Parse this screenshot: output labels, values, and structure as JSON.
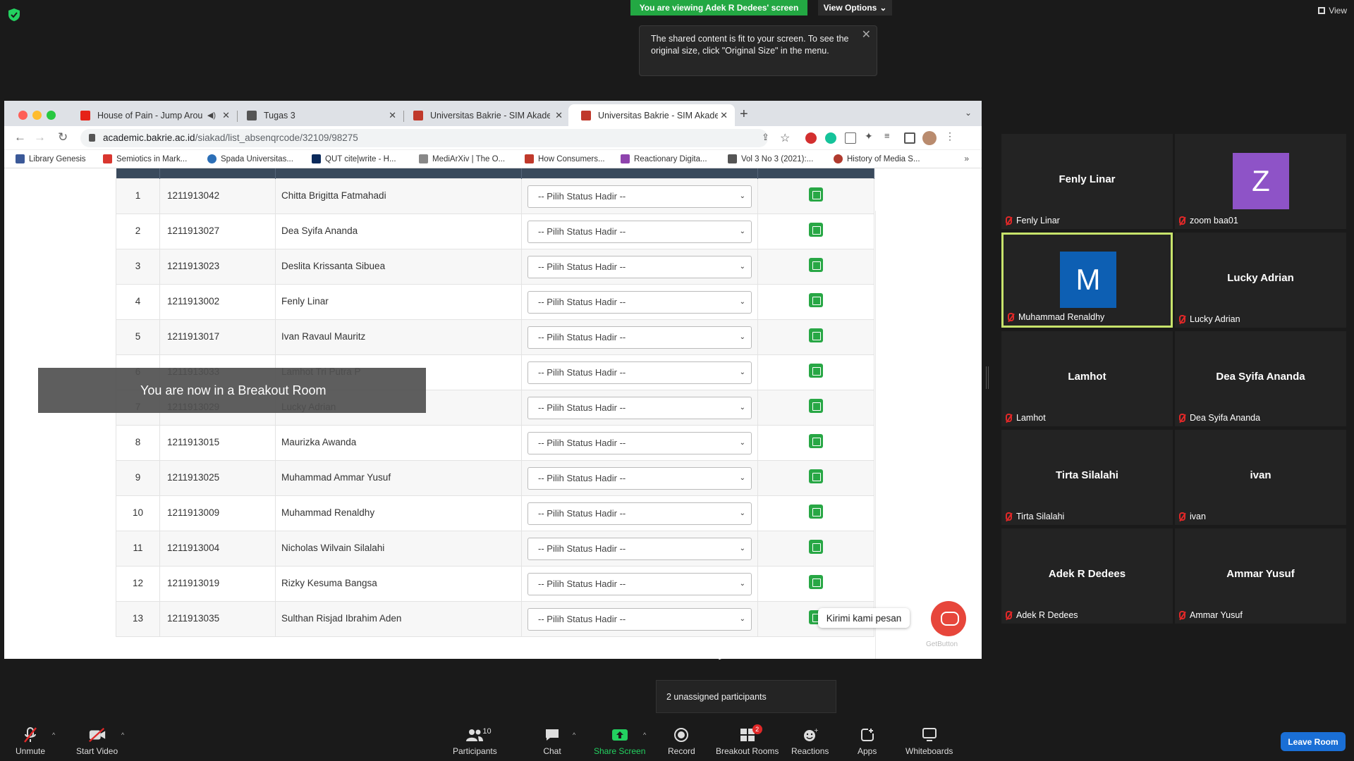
{
  "zoom": {
    "viewing_banner": "You are viewing Adek R Dedees' screen",
    "view_options": "View Options",
    "view_label": "View",
    "tooltip": "The shared content is fit to your screen. To see the original size, click \"Original Size\" in the menu.",
    "breakout_toast": "You are now in a Breakout Room",
    "unassigned": "2 unassigned participants",
    "leave_room": "Leave Room",
    "chat_widget_bubble": "Kirimi kami pesan",
    "getbutton": "GetButton"
  },
  "browser": {
    "tabs": [
      {
        "title": "House of Pain - Jump Arou",
        "color": "#e62117"
      },
      {
        "title": "Tugas 3",
        "color": "#555555"
      },
      {
        "title": "Universitas Bakrie - SIM Akade",
        "color": "#c0392b"
      },
      {
        "title": "Universitas Bakrie - SIM Akade",
        "color": "#c0392b"
      }
    ],
    "url_host": "academic.bakrie.ac.id",
    "url_path": "/siakad/list_absenqrcode/32109/98275",
    "bookmarks": [
      {
        "label": "Library Genesis",
        "color": "#3b5998"
      },
      {
        "label": "Semiotics in Mark...",
        "color": "#d9362f"
      },
      {
        "label": "Spada Universitas...",
        "color": "#2c6fb7"
      },
      {
        "label": "QUT cite|write - H...",
        "color": "#0b2a5b"
      },
      {
        "label": "MediArXiv | The O...",
        "color": "#888888"
      },
      {
        "label": "How Consumers...",
        "color": "#c0392b"
      },
      {
        "label": "Reactionary Digita...",
        "color": "#8e44ad"
      },
      {
        "label": "Vol 3 No 3 (2021):...",
        "color": "#555555"
      },
      {
        "label": "History of Media S...",
        "color": "#b03a2e"
      }
    ]
  },
  "table": {
    "select_placeholder": "-- Pilih Status Hadir --",
    "rows": [
      {
        "no": "1",
        "nim": "1211913042",
        "nama": "Chitta Brigitta Fatmahadi"
      },
      {
        "no": "2",
        "nim": "1211913027",
        "nama": "Dea Syifa Ananda"
      },
      {
        "no": "3",
        "nim": "1211913023",
        "nama": "Deslita Krissanta Sibuea"
      },
      {
        "no": "4",
        "nim": "1211913002",
        "nama": "Fenly Linar"
      },
      {
        "no": "5",
        "nim": "1211913017",
        "nama": "Ivan Ravaul Mauritz"
      },
      {
        "no": "6",
        "nim": "1211913033",
        "nama": "Lamhot Tri Putra P"
      },
      {
        "no": "7",
        "nim": "1211913029",
        "nama": "Lucky Adrian"
      },
      {
        "no": "8",
        "nim": "1211913015",
        "nama": "Maurizka Awanda"
      },
      {
        "no": "9",
        "nim": "1211913025",
        "nama": "Muhammad Ammar Yusuf"
      },
      {
        "no": "10",
        "nim": "1211913009",
        "nama": "Muhammad Renaldhy"
      },
      {
        "no": "11",
        "nim": "1211913004",
        "nama": "Nicholas Wilvain Silalahi"
      },
      {
        "no": "12",
        "nim": "1211913019",
        "nama": "Rizky Kesuma Bangsa"
      },
      {
        "no": "13",
        "nim": "1211913035",
        "nama": "Sulthan Risjad Ibrahim Aden"
      }
    ]
  },
  "participants": [
    {
      "display": "Fenly Linar",
      "name": "Fenly Linar"
    },
    {
      "display": "Z",
      "name": "zoom baa01",
      "avatar_color": "#8e53c7"
    },
    {
      "display": "M",
      "name": "Muhammad Renaldhy",
      "avatar_color": "#0d5fb3",
      "active": true
    },
    {
      "display": "Lucky Adrian",
      "name": "Lucky Adrian"
    },
    {
      "display": "Lamhot",
      "name": "Lamhot"
    },
    {
      "display": "Dea Syifa Ananda",
      "name": "Dea Syifa Ananda"
    },
    {
      "display": "Tirta Silalahi",
      "name": "Tirta Silalahi"
    },
    {
      "display": "ivan",
      "name": "ivan"
    },
    {
      "display": "Adek R Dedees",
      "name": "Adek R Dedees"
    },
    {
      "display": "Ammar Yusuf",
      "name": "Ammar Yusuf"
    }
  ],
  "controls": {
    "unmute": "Unmute",
    "start_video": "Start Video",
    "participants": "Participants",
    "participants_count": "10",
    "chat": "Chat",
    "share_screen": "Share Screen",
    "record": "Record",
    "breakout_rooms": "Breakout Rooms",
    "breakout_badge": "2",
    "reactions": "Reactions",
    "apps": "Apps",
    "whiteboards": "Whiteboards"
  },
  "colors": {
    "zoom_green": "#23a843",
    "active_speaker": "#c7e36b",
    "leave_blue": "#1a6fd6",
    "save_green": "#28a745"
  }
}
